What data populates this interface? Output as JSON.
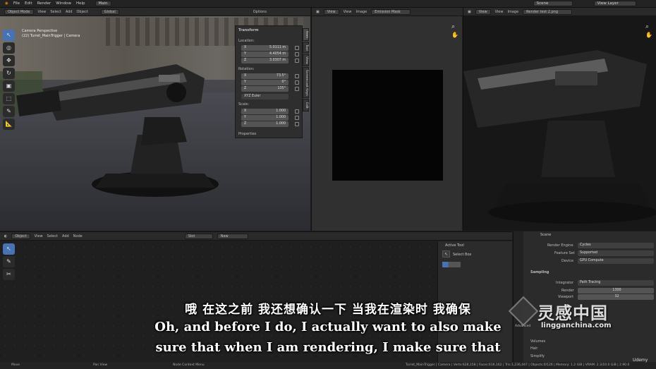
{
  "topbar": {
    "menu": [
      "File",
      "Edit",
      "Render",
      "Window",
      "Help"
    ],
    "workspace_tab": "Main",
    "scene": "Scene",
    "view_layer": "View Layer"
  },
  "viewport3d": {
    "mode": "Object Mode",
    "menus": [
      "View",
      "Select",
      "Add",
      "Object"
    ],
    "transform_orient": "Global",
    "options": "Options",
    "cam_title": "Camera Perspective",
    "cam_sub": "(22) Turret_MainTrigger | Camera"
  },
  "npanel": {
    "transform": "Transform",
    "location": "Location:",
    "loc": [
      {
        "k": "X",
        "v": "5.0111 m"
      },
      {
        "k": "Y",
        "v": "4.4054 m"
      },
      {
        "k": "Z",
        "v": "3.0307 m"
      }
    ],
    "rotation": "Rotation:",
    "rot": [
      {
        "k": "X",
        "v": "73.5°"
      },
      {
        "k": "Y",
        "v": "0°"
      },
      {
        "k": "Z",
        "v": "135°"
      }
    ],
    "euler": "XYZ Euler",
    "scale": "Scale:",
    "scl": [
      {
        "k": "X",
        "v": "1.000"
      },
      {
        "k": "Y",
        "v": "1.000"
      },
      {
        "k": "Z",
        "v": "1.000"
      }
    ],
    "properties": "Properties",
    "tabs": [
      "Item",
      "Tool",
      "View",
      "Screencast Keys",
      "Edit"
    ]
  },
  "image_editor1": {
    "menus": [
      "View",
      "View",
      "Image"
    ],
    "image": "Emission Mask"
  },
  "image_editor2": {
    "menus": [
      "View",
      "View",
      "Image"
    ],
    "image": "Render test 2.png"
  },
  "node_editor": {
    "type": "Object",
    "menus": [
      "View",
      "Select",
      "Add",
      "Node"
    ],
    "slot": "Slot",
    "new": "New",
    "active_tool": "Active Tool",
    "select_box": "Select Box"
  },
  "properties": {
    "scene": "Scene",
    "render_engine_label": "Render Engine",
    "render_engine": "Cycles",
    "feature_set_label": "Feature Set",
    "feature_set": "Supported",
    "device_label": "Device",
    "device": "GPU Compute",
    "sampling": "Sampling",
    "integrator_label": "Integrator",
    "integrator": "Path Tracing",
    "render_label": "Render",
    "render_samples": "1300",
    "viewport_label": "Viewport",
    "viewport_samples": "32",
    "volumes": "Volumes",
    "hair": "Hair",
    "simplify": "Simplify"
  },
  "statusbar": {
    "items": [
      "Move",
      "Pan View",
      "Node Context Menu"
    ],
    "stats": "Turret_MainTrigger | Camera | Verts:628,158 | Faces:616,162 | Tris:1,236,447 | Objects:0/126 | Memory: 1.2 GiB | VRAM: 2.3/10.0 GiB | 2.90.0"
  },
  "subtitles": {
    "chinese": "哦 在这之前 我还想确认一下 当我在渲染时 我确保",
    "line1": "Oh, and before I do, I actually want to also make",
    "line2": "sure that when I am rendering, I make sure that"
  },
  "watermark": {
    "brand": "灵感中国",
    "domain": "lingganchina.com",
    "udemy": "Udemy",
    "advanced": "Advanced"
  }
}
